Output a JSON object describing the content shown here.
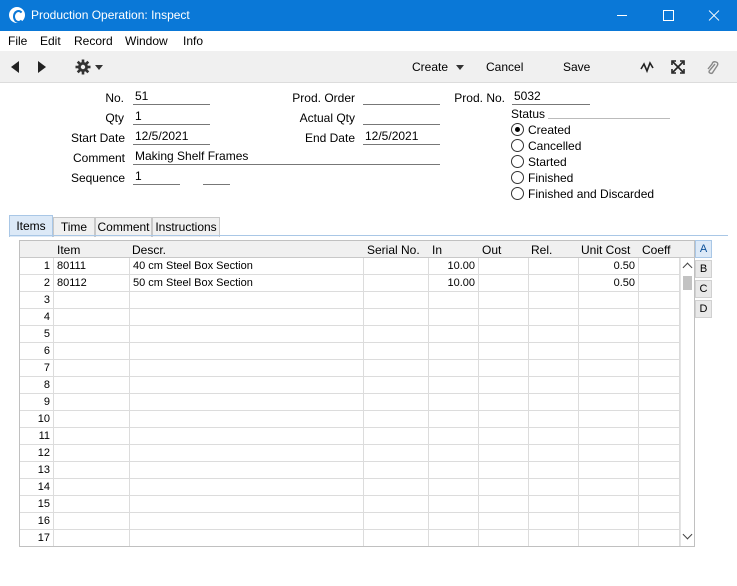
{
  "window": {
    "title": "Production Operation: Inspect"
  },
  "menu": [
    "File",
    "Edit",
    "Record",
    "Window",
    "Info"
  ],
  "toolbar": {
    "create_label": "Create",
    "cancel_label": "Cancel",
    "save_label": "Save"
  },
  "header": {
    "no_label": "No.",
    "no_value": "51",
    "qty_label": "Qty",
    "qty_value": "1",
    "start_date_label": "Start Date",
    "start_date_value": "12/5/2021",
    "comment_label": "Comment",
    "comment_value": "Making Shelf Frames",
    "sequence_label": "Sequence",
    "sequence_value": "1",
    "sequence_value2": "",
    "prod_order_label": "Prod. Order",
    "prod_order_value": "",
    "actual_qty_label": "Actual Qty",
    "actual_qty_value": "",
    "end_date_label": "End Date",
    "end_date_value": "12/5/2021",
    "prod_no_label": "Prod. No.",
    "prod_no_value": "5032",
    "status_label": "Status",
    "status_options": [
      "Created",
      "Cancelled",
      "Started",
      "Finished",
      "Finished and Discarded"
    ],
    "status_selected": "Created"
  },
  "tabs": [
    "Items",
    "Time",
    "Comment",
    "Instructions"
  ],
  "active_tab": "Items",
  "grid": {
    "columns": [
      "Item",
      "Descr.",
      "Serial No.",
      "In",
      "Out",
      "Rel.",
      "Unit Cost",
      "Coeff"
    ],
    "rows": [
      {
        "n": "1",
        "item": "80111",
        "descr": "40 cm Steel Box Section",
        "serial": "",
        "in": "10.00",
        "out": "",
        "rel": "",
        "unit_cost": "0.50",
        "coeff": ""
      },
      {
        "n": "2",
        "item": "80112",
        "descr": "50 cm Steel Box Section",
        "serial": "",
        "in": "10.00",
        "out": "",
        "rel": "",
        "unit_cost": "0.50",
        "coeff": ""
      },
      {
        "n": "3",
        "item": "",
        "descr": "",
        "serial": "",
        "in": "",
        "out": "",
        "rel": "",
        "unit_cost": "",
        "coeff": ""
      },
      {
        "n": "4",
        "item": "",
        "descr": "",
        "serial": "",
        "in": "",
        "out": "",
        "rel": "",
        "unit_cost": "",
        "coeff": ""
      },
      {
        "n": "5",
        "item": "",
        "descr": "",
        "serial": "",
        "in": "",
        "out": "",
        "rel": "",
        "unit_cost": "",
        "coeff": ""
      },
      {
        "n": "6",
        "item": "",
        "descr": "",
        "serial": "",
        "in": "",
        "out": "",
        "rel": "",
        "unit_cost": "",
        "coeff": ""
      },
      {
        "n": "7",
        "item": "",
        "descr": "",
        "serial": "",
        "in": "",
        "out": "",
        "rel": "",
        "unit_cost": "",
        "coeff": ""
      },
      {
        "n": "8",
        "item": "",
        "descr": "",
        "serial": "",
        "in": "",
        "out": "",
        "rel": "",
        "unit_cost": "",
        "coeff": ""
      },
      {
        "n": "9",
        "item": "",
        "descr": "",
        "serial": "",
        "in": "",
        "out": "",
        "rel": "",
        "unit_cost": "",
        "coeff": ""
      },
      {
        "n": "10",
        "item": "",
        "descr": "",
        "serial": "",
        "in": "",
        "out": "",
        "rel": "",
        "unit_cost": "",
        "coeff": ""
      },
      {
        "n": "11",
        "item": "",
        "descr": "",
        "serial": "",
        "in": "",
        "out": "",
        "rel": "",
        "unit_cost": "",
        "coeff": ""
      },
      {
        "n": "12",
        "item": "",
        "descr": "",
        "serial": "",
        "in": "",
        "out": "",
        "rel": "",
        "unit_cost": "",
        "coeff": ""
      },
      {
        "n": "13",
        "item": "",
        "descr": "",
        "serial": "",
        "in": "",
        "out": "",
        "rel": "",
        "unit_cost": "",
        "coeff": ""
      },
      {
        "n": "14",
        "item": "",
        "descr": "",
        "serial": "",
        "in": "",
        "out": "",
        "rel": "",
        "unit_cost": "",
        "coeff": ""
      },
      {
        "n": "15",
        "item": "",
        "descr": "",
        "serial": "",
        "in": "",
        "out": "",
        "rel": "",
        "unit_cost": "",
        "coeff": ""
      },
      {
        "n": "16",
        "item": "",
        "descr": "",
        "serial": "",
        "in": "",
        "out": "",
        "rel": "",
        "unit_cost": "",
        "coeff": ""
      },
      {
        "n": "17",
        "item": "",
        "descr": "",
        "serial": "",
        "in": "",
        "out": "",
        "rel": "",
        "unit_cost": "",
        "coeff": ""
      }
    ]
  },
  "side_tabs": [
    "A",
    "B",
    "C",
    "D"
  ],
  "active_side_tab": "A",
  "colors": {
    "titlebar": "#0a78d7",
    "toolbar": "#f0f0f0",
    "active_tab": "#dce9f7"
  }
}
